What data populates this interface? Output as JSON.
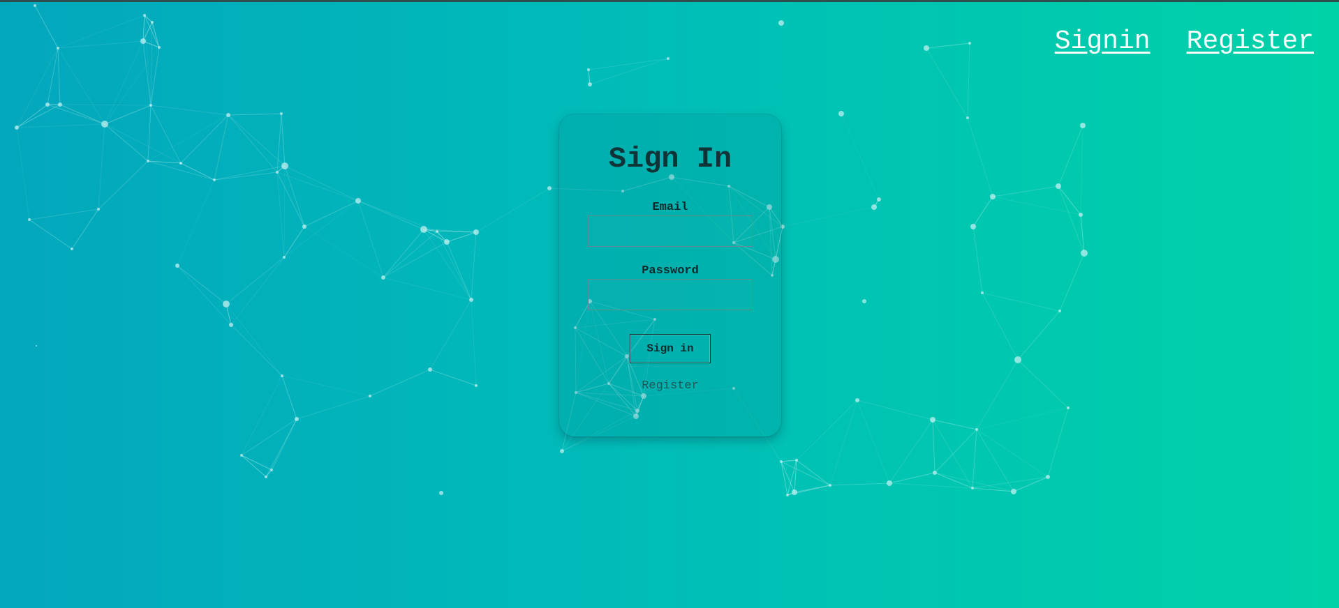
{
  "nav": {
    "signin_label": "Signin",
    "register_label": "Register"
  },
  "form": {
    "title": "Sign In",
    "email_label": "Email",
    "email_value": "",
    "password_label": "Password",
    "password_value": "",
    "submit_label": "Sign in",
    "register_link": "Register"
  },
  "colors": {
    "gradient_start": "#03a7bd",
    "gradient_end": "#00d2a8",
    "network_node": "#bfeff0",
    "title_text": "#0f3438",
    "nav_text": "#ffffff"
  }
}
